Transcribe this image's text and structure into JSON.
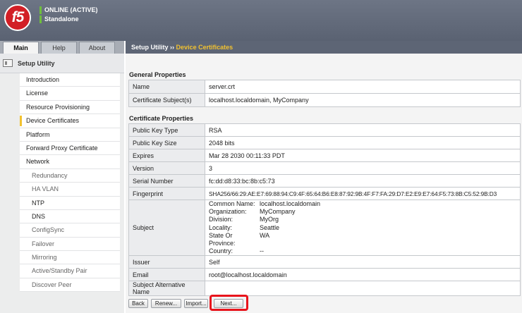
{
  "header": {
    "logo_text": "f5",
    "status_lines": [
      "ONLINE (ACTIVE)",
      "Standalone"
    ],
    "status_color": "#6fbf3c",
    "brand_color": "#d21f26"
  },
  "tabs": [
    "Main",
    "Help",
    "About"
  ],
  "breadcrumb": {
    "root": "Setup Utility",
    "separator": "››",
    "current": "Device Certificates"
  },
  "sidebar": {
    "title": "Setup Utility",
    "items": [
      {
        "label": "Introduction"
      },
      {
        "label": "License"
      },
      {
        "label": "Resource Provisioning"
      },
      {
        "label": "Device Certificates",
        "selected": true
      },
      {
        "label": "Platform"
      },
      {
        "label": "Forward Proxy Certificate"
      },
      {
        "label": "Network"
      },
      {
        "label": "Redundancy",
        "sub": true
      },
      {
        "label": "HA VLAN",
        "sub": true
      },
      {
        "label": "NTP",
        "sub": true
      },
      {
        "label": "DNS",
        "sub": true
      },
      {
        "label": "ConfigSync",
        "sub": true
      },
      {
        "label": "Failover",
        "sub": true
      },
      {
        "label": "Mirroring",
        "sub": true
      },
      {
        "label": "Active/Standby Pair",
        "sub": true
      },
      {
        "label": "Discover Peer",
        "sub": true
      }
    ]
  },
  "general": {
    "title": "General Properties",
    "rows": [
      {
        "label": "Name",
        "value": "server.crt"
      },
      {
        "label": "Certificate Subject(s)",
        "value": "localhost.localdomain, MyCompany"
      }
    ]
  },
  "certificate": {
    "title": "Certificate Properties",
    "rows_before": [
      {
        "label": "Public Key Type",
        "value": "RSA"
      },
      {
        "label": "Public Key Size",
        "value": "2048 bits"
      },
      {
        "label": "Expires",
        "value": "Mar 28 2030 00:11:33 PDT"
      },
      {
        "label": "Version",
        "value": "3"
      },
      {
        "label": "Serial Number",
        "value": "fc:dd:d8:33:bc:8b:c5:73"
      },
      {
        "label": "Fingerprint",
        "value": "SHA256/66:29:AE:E7:69:88:94:C9:4F:65:64:B6:E8:87:92:9B:4F:F7:FA:29:D7:E2:E9:E7:64:F5:73:8B:C5:52:9B:D3"
      }
    ],
    "subject": {
      "label": "Subject",
      "fields": [
        {
          "k": "Common Name:",
          "v": "localhost.localdomain"
        },
        {
          "k": "Organization:",
          "v": "MyCompany"
        },
        {
          "k": "Division:",
          "v": "MyOrg"
        },
        {
          "k": "Locality:",
          "v": "Seattle"
        },
        {
          "k": "State Or Province:",
          "v": "WA"
        },
        {
          "k": "Country:",
          "v": "--"
        }
      ]
    },
    "rows_after": [
      {
        "label": "Issuer",
        "value": "Self"
      },
      {
        "label": "Email",
        "value": "root@localhost.localdomain"
      },
      {
        "label": "Subject Alternative Name",
        "value": ""
      }
    ]
  },
  "buttons": {
    "back": "Back",
    "renew": "Renew...",
    "import": "Import...",
    "next": "Next..."
  }
}
